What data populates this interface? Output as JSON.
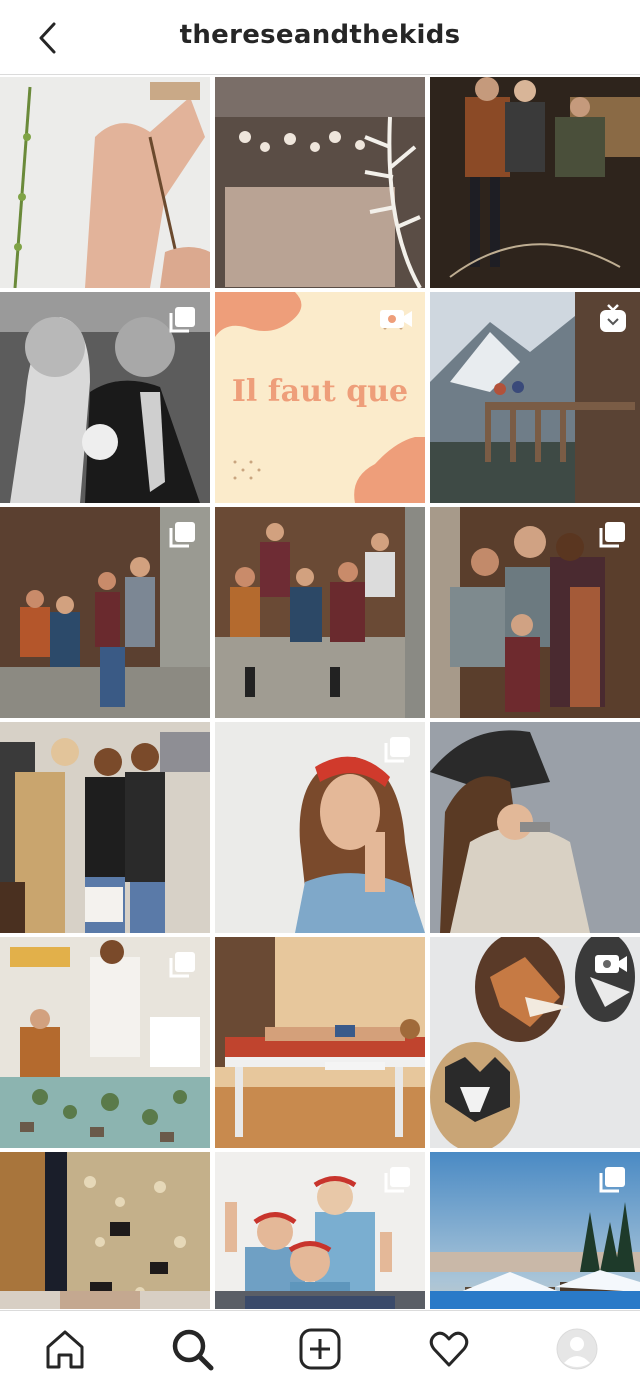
{
  "header": {
    "title": "thereseandthekids"
  },
  "post_text": {
    "quote": "Il faut que"
  },
  "colors": {
    "accent_peach": "#ee9e7a",
    "text_dark": "#262626",
    "divider": "#dbdbdb"
  },
  "grid_tiles": [
    {
      "row": 1,
      "col": 1,
      "subject": "hand holding twig",
      "badge": "none"
    },
    {
      "row": 1,
      "col": 2,
      "subject": "dried flowers",
      "badge": "none"
    },
    {
      "row": 1,
      "col": 3,
      "subject": "kids in dark room",
      "badge": "none"
    },
    {
      "row": 2,
      "col": 1,
      "subject": "wedding black and white",
      "badge": "carousel-icon"
    },
    {
      "row": 2,
      "col": 2,
      "subject": "quote card",
      "badge": "video-icon"
    },
    {
      "row": 2,
      "col": 3,
      "subject": "chalet balcony mountains",
      "badge": "igtv-icon"
    },
    {
      "row": 3,
      "col": 1,
      "subject": "family sitting wooden wall",
      "badge": "carousel-icon"
    },
    {
      "row": 3,
      "col": 2,
      "subject": "family group wooden wall",
      "badge": "none"
    },
    {
      "row": 3,
      "col": 3,
      "subject": "parents kissing kids",
      "badge": "carousel-icon"
    },
    {
      "row": 4,
      "col": 1,
      "subject": "three women shopping",
      "badge": "none"
    },
    {
      "row": 4,
      "col": 2,
      "subject": "woman red headband",
      "badge": "carousel-icon"
    },
    {
      "row": 4,
      "col": 3,
      "subject": "woman with hat",
      "badge": "none"
    },
    {
      "row": 5,
      "col": 1,
      "subject": "kids playroom toys",
      "badge": "carousel-icon"
    },
    {
      "row": 5,
      "col": 2,
      "subject": "massage tables",
      "badge": "none"
    },
    {
      "row": 5,
      "col": 3,
      "subject": "animal masks on wall",
      "badge": "video-icon"
    },
    {
      "row": 6,
      "col": 1,
      "subject": "granola and chocolate",
      "badge": "none"
    },
    {
      "row": 6,
      "col": 2,
      "subject": "two women flexing",
      "badge": "carousel-icon"
    },
    {
      "row": 6,
      "col": 3,
      "subject": "snowy chalets sunset",
      "badge": "carousel-icon"
    }
  ],
  "nav": {
    "items": [
      "home-icon",
      "search-icon",
      "new-post-icon",
      "activity-heart-icon",
      "profile-avatar"
    ],
    "active": "search-icon"
  }
}
